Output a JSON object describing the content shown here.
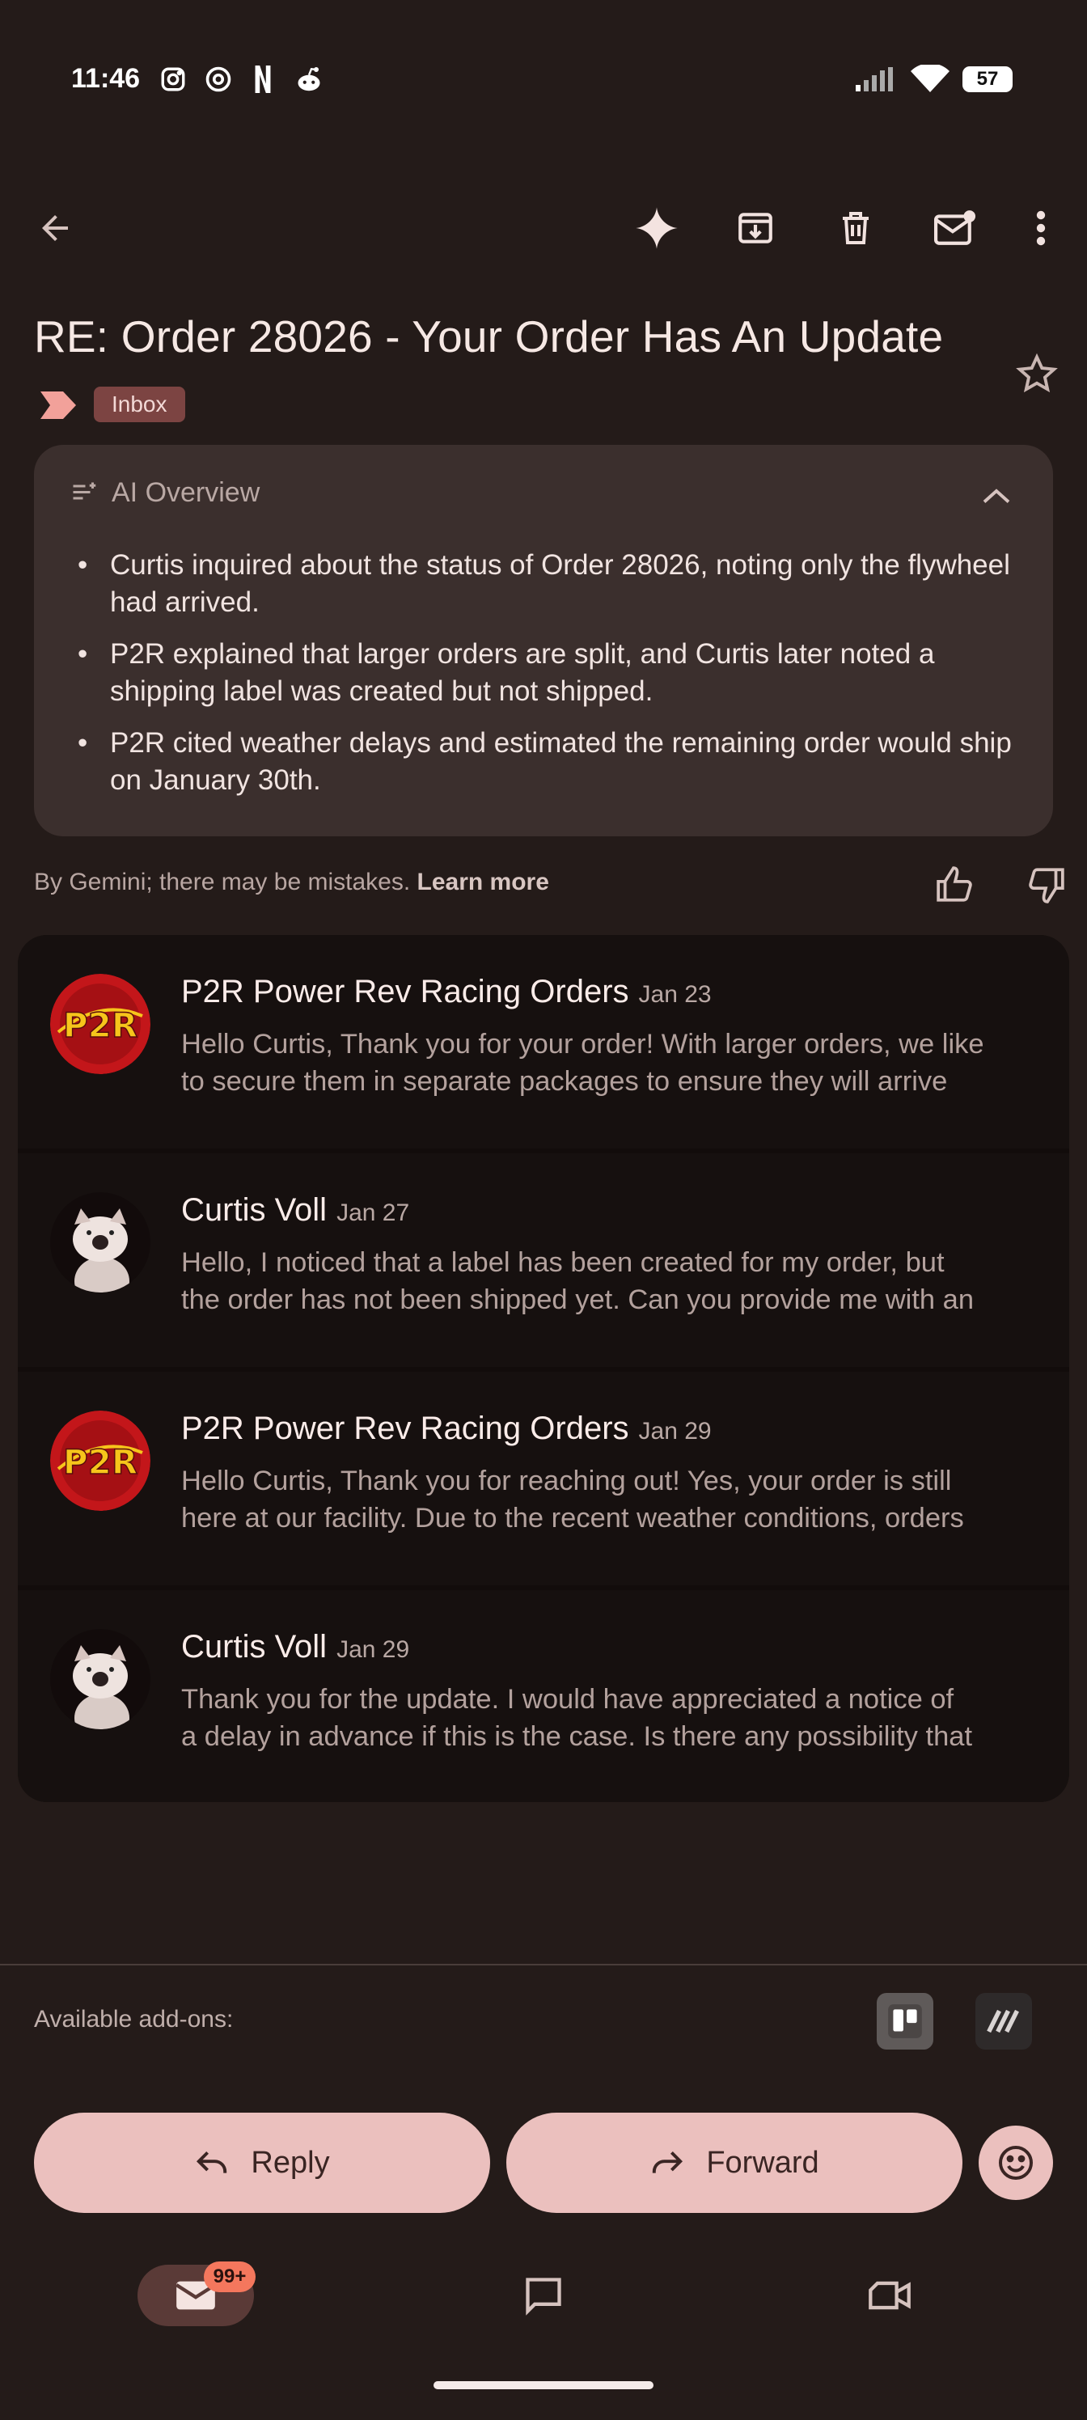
{
  "status_bar": {
    "time": "11:46",
    "battery": "57"
  },
  "thread": {
    "subject": "RE: Order 28026 - Your Order Has An Update",
    "label": "Inbox"
  },
  "ai_overview": {
    "title": "AI Overview",
    "bullets": [
      "Curtis inquired about the status of Order 28026, noting only the flywheel had arrived.",
      "P2R explained that larger orders are split, and Curtis later noted a shipping label was created but not shipped.",
      "P2R cited weather delays and estimated the remaining order would ship on January 30th."
    ],
    "disclaimer": "By Gemini; there may be mistakes.",
    "learn_more": "Learn more"
  },
  "messages": [
    {
      "sender": "P2R Power Rev Racing Orders",
      "date": "Jan 23",
      "line1": "Hello Curtis, Thank you for your order! With larger orders, we like",
      "line2": "to secure them in separate packages to ensure they will arrive"
    },
    {
      "sender": "Curtis Voll",
      "date": "Jan 27",
      "line1": "Hello, I noticed that a label has been created for my order, but",
      "line2": "the order has not been shipped yet. Can you provide me with an"
    },
    {
      "sender": "P2R Power Rev Racing Orders",
      "date": "Jan 29",
      "line1": "Hello Curtis, Thank you for reaching out! Yes, your order is still",
      "line2": "here at our facility. Due to the recent weather conditions, orders"
    },
    {
      "sender": "Curtis Voll",
      "date": "Jan 29",
      "line1": "Thank you for the update. I would have appreciated a notice of",
      "line2": "a delay in advance if this is the case. Is there any possibility that"
    }
  ],
  "avatars": {
    "p2r_logo_text": "P2R"
  },
  "addons": {
    "label": "Available add-ons:"
  },
  "actions": {
    "reply": "Reply",
    "forward": "Forward"
  },
  "nav": {
    "mail_badge": "99+"
  },
  "colors": {
    "background": "#241b19",
    "accent_pill": "#ebc0be",
    "badge": "#f4775d",
    "card": "#3b2f2d"
  }
}
